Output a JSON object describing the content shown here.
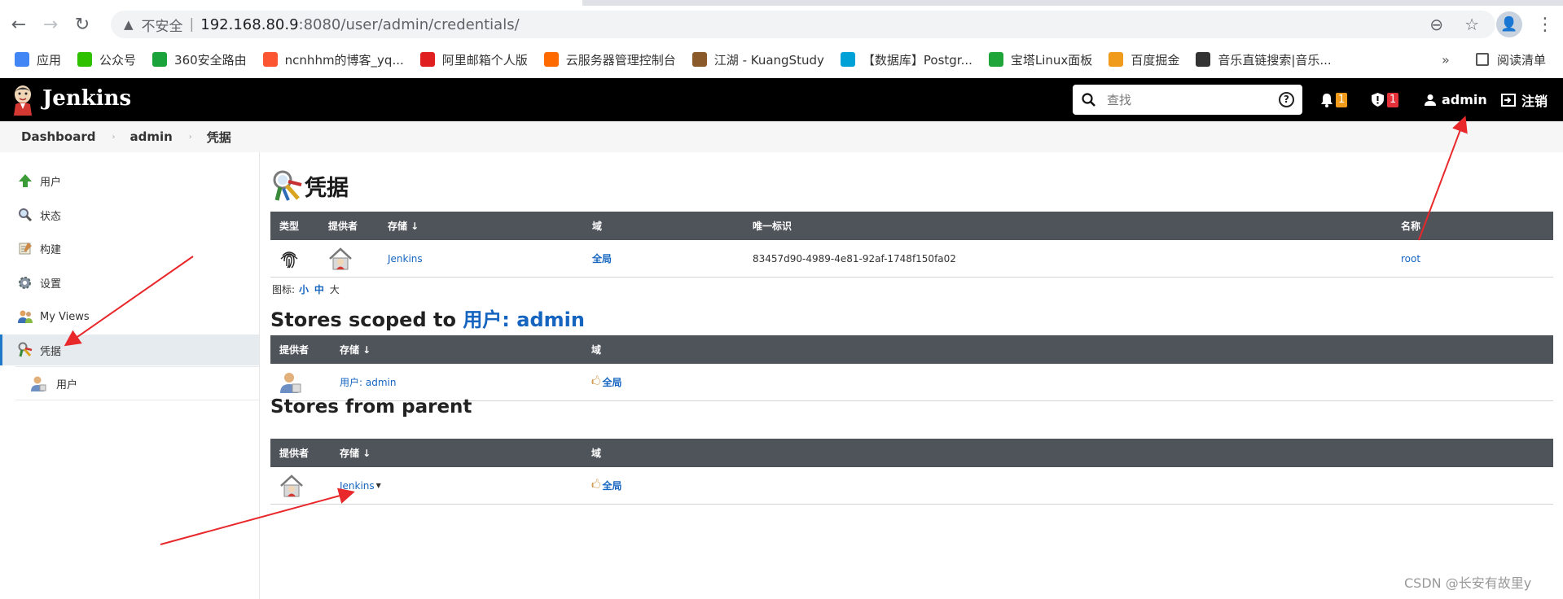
{
  "browser": {
    "insecure_label": "不安全",
    "url_host": "192.168.80.9",
    "url_rest": ":8080/user/admin/credentials/",
    "bookmarks": [
      {
        "label": "应用",
        "icon": "apps-grid-icon",
        "color": "#4285f4"
      },
      {
        "label": "公众号",
        "icon": "wechat-icon",
        "color": "#2dc100"
      },
      {
        "label": "360安全路由",
        "icon": "360-router-icon",
        "color": "#1aa33a"
      },
      {
        "label": "ncnhhm的博客_yq...",
        "icon": "csdn-icon",
        "color": "#fc5531"
      },
      {
        "label": "阿里邮箱个人版",
        "icon": "aliyun-mail-icon",
        "color": "#e02020"
      },
      {
        "label": "云服务器管理控制台",
        "icon": "aliyun-console-icon",
        "color": "#ff6a00"
      },
      {
        "label": "江湖 - KuangStudy",
        "icon": "kuangstudy-icon",
        "color": "#8b5a2b"
      },
      {
        "label": "【数据库】Postgr...",
        "icon": "bilibili-icon",
        "color": "#00a1d6"
      },
      {
        "label": "宝塔Linux面板",
        "icon": "bt-panel-icon",
        "color": "#20a53a"
      },
      {
        "label": "百度掘金",
        "icon": "juejin-icon",
        "color": "#f09b1b"
      },
      {
        "label": "音乐直链搜索|音乐...",
        "icon": "music-search-icon",
        "color": "#333333"
      }
    ],
    "more_label": "»",
    "reading_list": "阅读清单"
  },
  "header": {
    "title": "Jenkins",
    "search_placeholder": "查找",
    "notif_count": "1",
    "security_count": "1",
    "user": "admin",
    "logout": "注销"
  },
  "breadcrumb": [
    "Dashboard",
    "admin",
    "凭据"
  ],
  "sidebar": {
    "items": [
      {
        "label": "用户",
        "icon": "up-arrow-icon"
      },
      {
        "label": "状态",
        "icon": "magnifier-icon"
      },
      {
        "label": "构建",
        "icon": "notepad-icon"
      },
      {
        "label": "设置",
        "icon": "gear-icon"
      },
      {
        "label": "My Views",
        "icon": "user-group-icon"
      },
      {
        "label": "凭据",
        "icon": "credentials-keys-icon"
      }
    ],
    "sub_items": [
      {
        "label": "用户",
        "icon": "user-icon"
      }
    ]
  },
  "main": {
    "title": "凭据",
    "credentials_table": {
      "headers": [
        "类型",
        "提供者",
        "存储 ↓",
        "域",
        "唯一标识",
        "名称"
      ],
      "rows": [
        {
          "type_icon": "fingerprint-icon",
          "provider_icon": "jenkins-home-icon",
          "store": "Jenkins",
          "domain": "全局",
          "id": "83457d90-4989-4e81-92af-1748f150fa02",
          "name": "root"
        }
      ]
    },
    "icon_size": {
      "label": "图标:",
      "small": "小",
      "medium": "中",
      "large": "大"
    },
    "scoped_title_prefix": "Stores scoped to ",
    "scoped_title_link": "用户: admin",
    "scoped_table": {
      "headers": [
        "提供者",
        "存储 ↓",
        "域"
      ],
      "rows": [
        {
          "provider_icon": "user-provider-icon",
          "store": "用户: admin",
          "domain": "全局"
        }
      ]
    },
    "parent_title": "Stores from parent",
    "parent_table": {
      "headers": [
        "提供者",
        "存储 ↓",
        "域"
      ],
      "rows": [
        {
          "provider_icon": "jenkins-home-icon",
          "store": "Jenkins",
          "domain": "全局"
        }
      ]
    }
  },
  "watermark": "CSDN @长安有故里y"
}
